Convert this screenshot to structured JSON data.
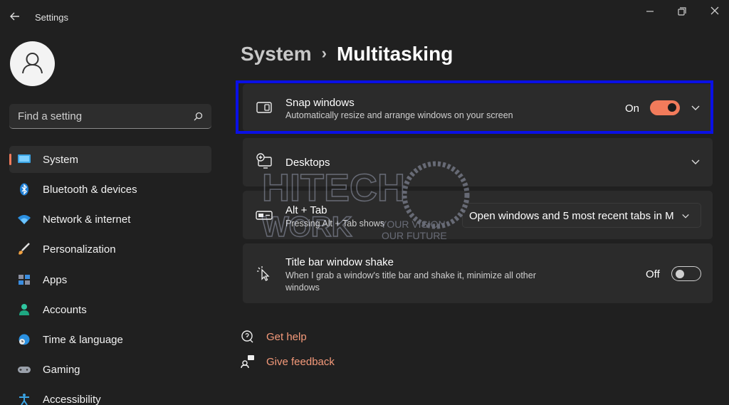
{
  "window": {
    "title": "Settings"
  },
  "user": {
    "avatar_icon": "person-icon"
  },
  "search": {
    "placeholder": "Find a setting"
  },
  "sidebar": {
    "items": [
      {
        "label": "System",
        "icon": "system-monitor-icon",
        "active": true
      },
      {
        "label": "Bluetooth & devices",
        "icon": "bluetooth-icon",
        "active": false
      },
      {
        "label": "Network & internet",
        "icon": "wifi-icon",
        "active": false
      },
      {
        "label": "Personalization",
        "icon": "paintbrush-icon",
        "active": false
      },
      {
        "label": "Apps",
        "icon": "apps-icon",
        "active": false
      },
      {
        "label": "Accounts",
        "icon": "account-icon",
        "active": false
      },
      {
        "label": "Time & language",
        "icon": "globe-clock-icon",
        "active": false
      },
      {
        "label": "Gaming",
        "icon": "gamepad-icon",
        "active": false
      },
      {
        "label": "Accessibility",
        "icon": "accessibility-icon",
        "active": false
      }
    ]
  },
  "breadcrumb": {
    "parent": "System",
    "separator": "›",
    "current": "Multitasking"
  },
  "settings": {
    "snap": {
      "title": "Snap windows",
      "subtitle": "Automatically resize and arrange windows on your screen",
      "state_label": "On",
      "enabled": true
    },
    "desktops": {
      "title": "Desktops"
    },
    "alt_tab": {
      "title": "Alt + Tab",
      "subtitle": "Pressing Alt + Tab shows",
      "selected": "Open windows and 5 most recent tabs in M"
    },
    "shake": {
      "title": "Title bar window shake",
      "subtitle": "When I grab a window's title bar and shake it, minimize all other windows",
      "state_label": "Off",
      "enabled": false
    }
  },
  "links": {
    "help": "Get help",
    "feedback": "Give feedback"
  },
  "watermark": {
    "line1": "HITECH",
    "line2": "WORK",
    "tagline1": "YOUR VISION",
    "tagline2": "OUR FUTURE"
  },
  "colors": {
    "accent": "#f27b5b",
    "highlight_border": "#0a10e6",
    "background": "#202020",
    "card": "#2b2b2b"
  }
}
